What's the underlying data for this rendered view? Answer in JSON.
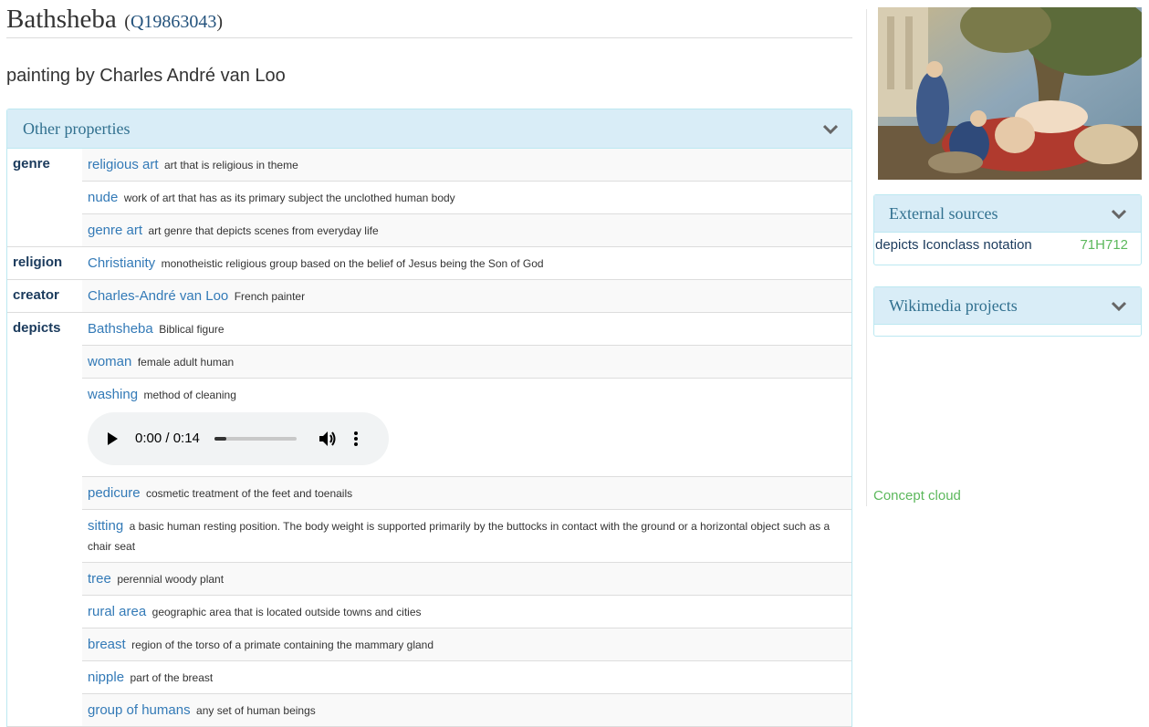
{
  "item": {
    "title": "Bathsheba",
    "qid_open": "(",
    "qid": "Q19863043",
    "qid_close": ")",
    "description": "painting by Charles André van Loo"
  },
  "other_properties": {
    "heading": "Other properties",
    "groups": [
      {
        "name": "genre",
        "values": [
          {
            "label": "religious art",
            "desc": "art that is religious in theme"
          },
          {
            "label": "nude",
            "desc": "work of art that has as its primary subject the unclothed human body"
          },
          {
            "label": "genre art",
            "desc": "art genre that depicts scenes from everyday life"
          }
        ]
      },
      {
        "name": "religion",
        "values": [
          {
            "label": "Christianity",
            "desc": "monotheistic religious group based on the belief of Jesus being the Son of God"
          }
        ]
      },
      {
        "name": "creator",
        "values": [
          {
            "label": "Charles-André van Loo",
            "desc": "French painter"
          }
        ]
      },
      {
        "name": "depicts",
        "values": [
          {
            "label": "Bathsheba",
            "desc": "Biblical figure"
          },
          {
            "label": "woman",
            "desc": "female adult human"
          },
          {
            "label": "washing",
            "desc": "method of cleaning"
          },
          {
            "label": "pedicure",
            "desc": "cosmetic treatment of the feet and toenails"
          },
          {
            "label": "sitting",
            "desc": "a basic human resting position. The body weight is supported primarily by the buttocks in contact with the ground or a horizontal object such as a chair seat"
          },
          {
            "label": "tree",
            "desc": "perennial woody plant"
          },
          {
            "label": "rural area",
            "desc": "geographic area that is located outside towns and cities"
          },
          {
            "label": "breast",
            "desc": "region of the torso of a primate containing the mammary gland"
          },
          {
            "label": "nipple",
            "desc": "part of the breast"
          },
          {
            "label": "group of humans",
            "desc": "any set of human beings"
          }
        ]
      }
    ]
  },
  "audio": {
    "time": "0:00 / 0:14",
    "progress_fraction": 0.0
  },
  "external_sources": {
    "heading": "External sources",
    "rows": [
      {
        "label": "depicts Iconclass notation",
        "code": "71H712"
      }
    ]
  },
  "wikimedia_projects": {
    "heading": "Wikimedia projects"
  },
  "concept_cloud": "Concept cloud",
  "colors": {
    "panel_bg": "#d9edf7",
    "panel_border": "#bce8f1",
    "link": "#337ab7",
    "green": "#5cb85c"
  }
}
